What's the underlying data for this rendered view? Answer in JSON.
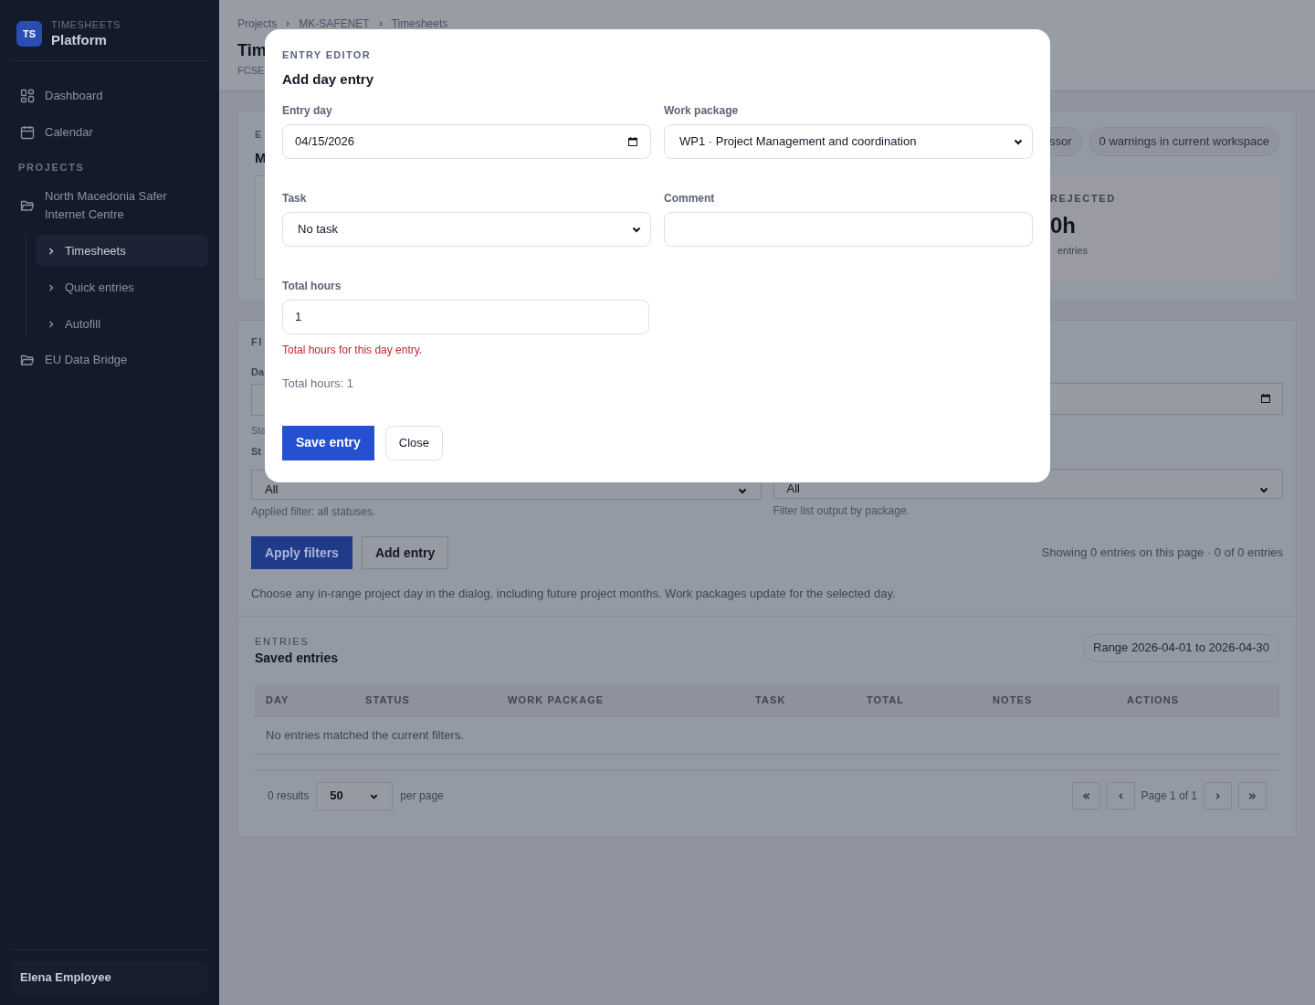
{
  "sidebar": {
    "brand": {
      "badge": "TS",
      "eyebrow": "TIMESHEETS",
      "title": "Platform"
    },
    "nav": [
      {
        "label": "Dashboard"
      },
      {
        "label": "Calendar"
      }
    ],
    "section": "PROJECTS",
    "projects": [
      {
        "label": "North Macedonia Safer Internet Centre",
        "children": [
          {
            "label": "Timesheets",
            "selected": true
          },
          {
            "label": "Quick entries",
            "selected": false
          },
          {
            "label": "Autofill",
            "selected": false
          }
        ]
      },
      {
        "label": "EU Data Bridge"
      }
    ],
    "user": "Elena Employee"
  },
  "breadcrumb": [
    "Projects",
    "MK-SAFENET",
    "Timesheets"
  ],
  "page_header": {
    "title": "Tim",
    "subtitle": "FCSE"
  },
  "overview": {
    "eyebrow": "E",
    "title": "M",
    "pills": [
      "ssor",
      "0 warnings in current workspace"
    ],
    "rejected": {
      "label": "REJECTED",
      "value": "0h",
      "note": "entries"
    }
  },
  "filters": {
    "eyebrow": "FI",
    "date_label": "Da",
    "date_hint": "Sta",
    "status_label": "St",
    "status_value": "All",
    "status_hint": "Applied filter: all statuses.",
    "package_value": "All",
    "package_hint": "Filter list output by package.",
    "buttons": [
      {
        "label": "Apply filters",
        "kind": "primary"
      },
      {
        "label": "Add entry",
        "kind": "secondary"
      }
    ],
    "summary": "Showing 0 entries on this page · 0 of 0 entries",
    "note": "Choose any in-range project day in the dialog, including future project months. Work packages update for the selected day."
  },
  "entries": {
    "eyebrow": "ENTRIES",
    "title": "Saved entries",
    "range": "Range 2026-04-01 to 2026-04-30",
    "columns": [
      "DAY",
      "STATUS",
      "WORK PACKAGE",
      "TASK",
      "TOTAL",
      "NOTES",
      "ACTIONS"
    ],
    "empty": "No entries matched the current filters.",
    "results": "0 results",
    "per_page": "50",
    "per_page_label": "per page",
    "page": "Page 1 of 1"
  },
  "dialog": {
    "eyebrow": "ENTRY EDITOR",
    "title": "Add day entry",
    "fields": [
      {
        "kind": "date",
        "label": "Entry day",
        "value": "04/15/2026"
      },
      {
        "kind": "select",
        "label": "Work package",
        "value": "WP1 · Project Management and coordination"
      },
      {
        "kind": "select",
        "label": "Task",
        "value": "No task"
      },
      {
        "kind": "text",
        "label": "Comment"
      },
      {
        "kind": "text",
        "label": "Total hours",
        "value": "1",
        "error": "Total hours for this day entry."
      }
    ],
    "total": "Total hours: 1",
    "buttons": [
      {
        "label": "Save entry",
        "kind": "primary"
      },
      {
        "label": "Close",
        "kind": "secondary"
      }
    ]
  }
}
